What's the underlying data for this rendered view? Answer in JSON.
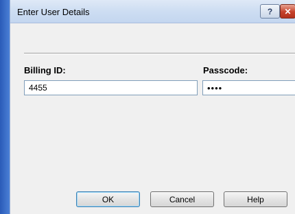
{
  "dialog": {
    "title": "Enter User Details",
    "help_glyph": "?",
    "close_glyph": "✕"
  },
  "form": {
    "billing_label": "Billing ID:",
    "billing_value": "4455",
    "passcode_label": "Passcode:",
    "passcode_value": "••••"
  },
  "buttons": {
    "ok": "OK",
    "cancel": "Cancel",
    "help": "Help"
  },
  "colors": {
    "desktop": "#3d6fc9",
    "dialog_bg": "#f0f0f0",
    "close_button": "#c5412b"
  }
}
